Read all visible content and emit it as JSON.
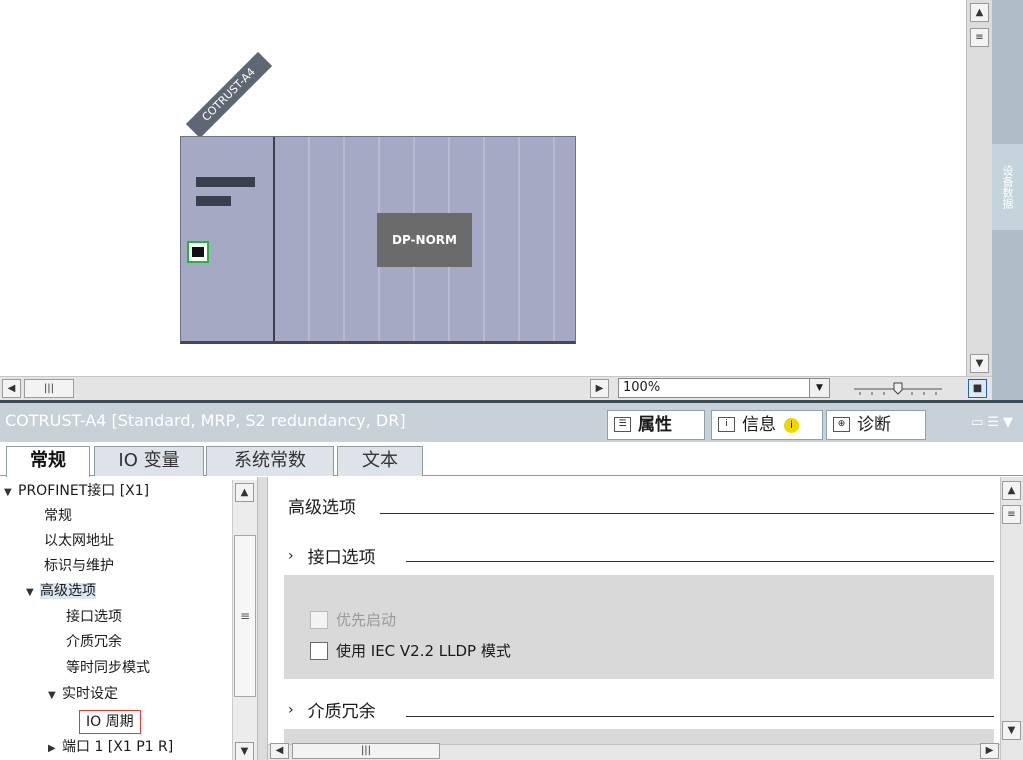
{
  "canvas": {
    "device_name": "COTRUST-A4",
    "module_label": "DP-NORM",
    "side_tab_label": "设备数据"
  },
  "toolbar": {
    "zoom_value": "100%"
  },
  "inspector": {
    "title": "COTRUST-A4 [Standard, MRP, S2 redundancy, DR]",
    "right_tabs": [
      {
        "label": "属性",
        "icon": "properties-icon"
      },
      {
        "label": "信息",
        "icon": "info-icon"
      },
      {
        "label": "诊断",
        "icon": "diagnostics-icon"
      }
    ],
    "tabs": [
      "常规",
      "IO 变量",
      "系统常数",
      "文本"
    ]
  },
  "tree": {
    "items": [
      {
        "label": "PROFINET接口 [X1]",
        "expanded": true
      },
      {
        "label": "常规"
      },
      {
        "label": "以太网地址"
      },
      {
        "label": "标识与维护"
      },
      {
        "label": "高级选项",
        "expanded": true
      },
      {
        "label": "接口选项"
      },
      {
        "label": "介质冗余"
      },
      {
        "label": "等时同步模式"
      },
      {
        "label": "实时设定",
        "expanded": true
      },
      {
        "label": "IO 周期",
        "selected": true
      },
      {
        "label": "端口 1 [X1 P1 R]",
        "expanded": false
      }
    ]
  },
  "content": {
    "section_advanced": "高级选项",
    "section_interface": "接口选项",
    "option_priority_startup": "优先启动",
    "option_iec_lldp": "使用 IEC V2.2 LLDP 模式",
    "section_media": "介质冗余"
  },
  "colors": {
    "rack": "#a6a9c3",
    "port_highlight": "#1fb83b",
    "selection_outline": "#e0412d",
    "title_bar": "#c8d1d8"
  }
}
